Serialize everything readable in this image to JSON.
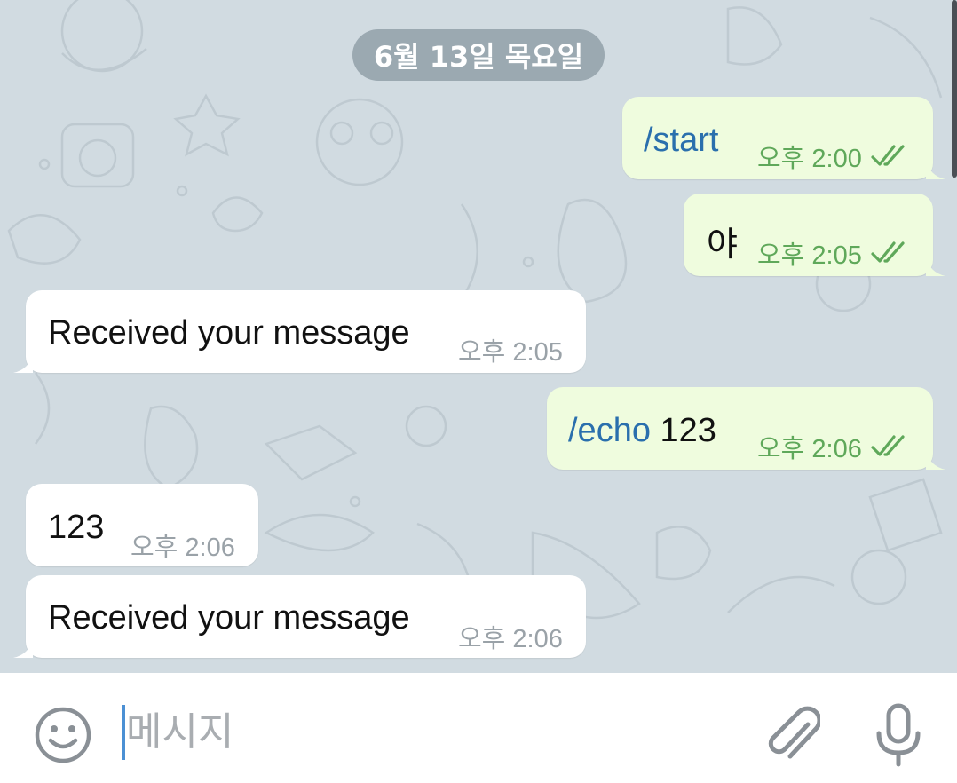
{
  "chat": {
    "date_separator": "6월 13일 목요일",
    "messages": [
      {
        "direction": "outgoing",
        "command": "/start",
        "text": "",
        "time": "오후 2:00",
        "status": "read"
      },
      {
        "direction": "outgoing",
        "command": "",
        "text": "야",
        "time": "오후 2:05",
        "status": "read"
      },
      {
        "direction": "incoming",
        "command": "",
        "text": "Received your message",
        "time": "오후 2:05"
      },
      {
        "direction": "outgoing",
        "command": "/echo",
        "text": " 123",
        "time": "오후 2:06",
        "status": "read"
      },
      {
        "direction": "incoming",
        "command": "",
        "text": "123",
        "time": "오후 2:06"
      },
      {
        "direction": "incoming",
        "command": "",
        "text": "Received your message",
        "time": "오후 2:06"
      }
    ]
  },
  "composer": {
    "placeholder": "메시지",
    "value": ""
  },
  "icons": {
    "emoji": "smiley-icon",
    "attach": "paperclip-icon",
    "mic": "microphone-icon",
    "read_status": "double-check-icon"
  },
  "colors": {
    "outgoing_bubble": "#effcde",
    "incoming_bubble": "#ffffff",
    "command_link": "#2a6fad",
    "outgoing_meta": "#5fa85a",
    "background": "#d1dbe1"
  }
}
